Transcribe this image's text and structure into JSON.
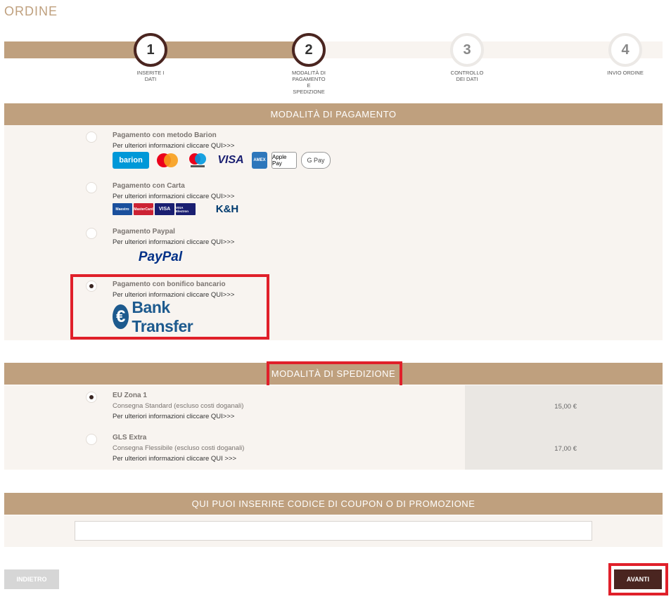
{
  "page": {
    "title": "ORDINE"
  },
  "steps": [
    {
      "number": "1",
      "label": "INSERITE I DATI"
    },
    {
      "number": "2",
      "label": "MODALITÀ DI PAGAMENTO E SPEDIZIONE"
    },
    {
      "number": "3",
      "label": "CONTROLLO DEI DATI"
    },
    {
      "number": "4",
      "label": "INVIO ORDINE"
    }
  ],
  "payment": {
    "heading": "MODALITÀ DI PAGAMENTO",
    "options": [
      {
        "title": "Pagamento con metodo Barion",
        "info": "Per ulteriori informazioni cliccare QUI>>>",
        "selected": false,
        "logos": [
          "barion",
          "Mastercard",
          "Maestro",
          "VISA",
          "AMEX",
          "Apple Pay",
          "G Pay"
        ]
      },
      {
        "title": "Pagamento con Carta",
        "info": "Per ulteriori informazioni cliccare QUI>>>",
        "selected": false,
        "logos": [
          "Maestro",
          "MasterCard",
          "VISA",
          "VISA Electron",
          "K&H"
        ]
      },
      {
        "title": "Pagamento Paypal",
        "info": "Per ulteriori informazioni cliccare QUI>>>",
        "selected": false,
        "logos": [
          "PayPal"
        ]
      },
      {
        "title": "Pagamento con bonifico bancario",
        "info": "Per ulteriori informazioni cliccare QUI>>>",
        "selected": true,
        "logos": [
          "Bank Transfer"
        ]
      }
    ]
  },
  "shipping": {
    "heading": "MODALITÀ DI SPEDIZIONE",
    "options": [
      {
        "title": "EU Zona 1",
        "desc": "Consegna Standard (escluso costi doganali)",
        "info": "Per ulteriori informazioni cliccare QUI>>>",
        "price": "15,00 €",
        "selected": true
      },
      {
        "title": "GLS Extra",
        "desc": "Consegna Flessibile (escluso costi doganali)",
        "info": "Per ulteriori informazioni cliccare QUI >>>",
        "price": "17,00 €",
        "selected": false
      }
    ]
  },
  "coupon": {
    "heading": "QUI PUOI INSERIRE CODICE DI COUPON O DI PROMOZIONE",
    "value": ""
  },
  "nav": {
    "back_label": "INDIETRO",
    "next_label": "AVANTI"
  },
  "colors": {
    "accent": "#bfa07e",
    "dark": "#4a2520",
    "highlight": "#e0202a",
    "panel": "#f8f4f0"
  }
}
